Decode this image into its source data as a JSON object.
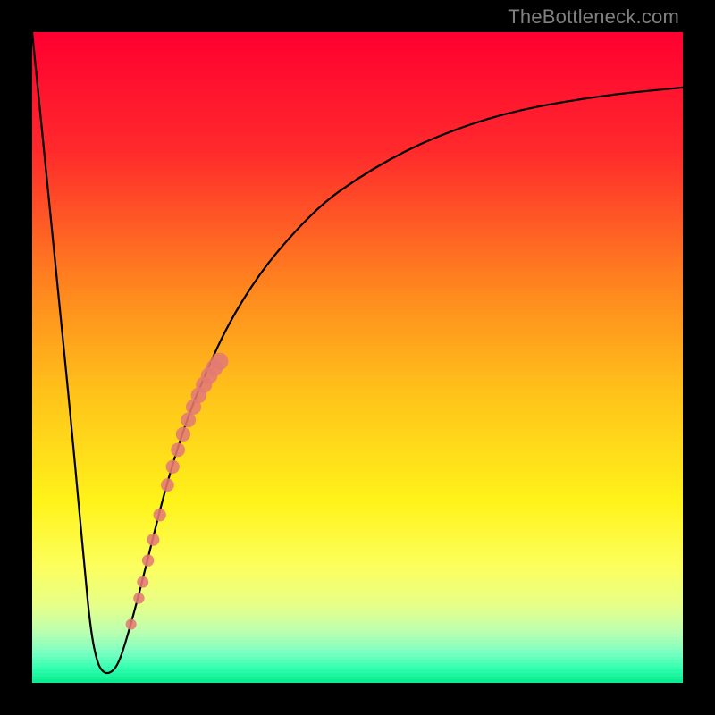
{
  "watermark": {
    "text": "TheBottleneck.com"
  },
  "chart_data": {
    "type": "line",
    "title": "",
    "xlabel": "",
    "ylabel": "",
    "xlim": [
      0,
      100
    ],
    "ylim": [
      0,
      100
    ],
    "grid": false,
    "legend": false,
    "background_gradient": {
      "direction": "vertical",
      "stops": [
        {
          "pos": 0.0,
          "color": "#ff0030"
        },
        {
          "pos": 0.18,
          "color": "#ff2a2c"
        },
        {
          "pos": 0.4,
          "color": "#ff8a1e"
        },
        {
          "pos": 0.55,
          "color": "#ffc21a"
        },
        {
          "pos": 0.72,
          "color": "#fff31a"
        },
        {
          "pos": 0.82,
          "color": "#fcff5e"
        },
        {
          "pos": 0.88,
          "color": "#e6ff8a"
        },
        {
          "pos": 0.92,
          "color": "#baffb0"
        },
        {
          "pos": 0.95,
          "color": "#7dffc2"
        },
        {
          "pos": 0.975,
          "color": "#33ffb0"
        },
        {
          "pos": 1.0,
          "color": "#00e888"
        }
      ]
    },
    "series": [
      {
        "name": "bottleneck-curve",
        "color": "#000000",
        "stroke_width": 2.2,
        "x": [
          0,
          2,
          4,
          6,
          8,
          9,
          10,
          11,
          12,
          13,
          14,
          16,
          18,
          20,
          22,
          24,
          26,
          30,
          35,
          40,
          45,
          50,
          55,
          60,
          65,
          70,
          75,
          80,
          85,
          90,
          95,
          100
        ],
        "y": [
          100,
          80,
          60,
          40,
          18,
          8,
          3,
          1.5,
          1.5,
          2.5,
          5,
          12,
          20,
          28,
          35,
          41,
          46,
          55,
          63,
          69,
          74,
          77.5,
          80.5,
          83,
          85,
          86.7,
          88,
          89,
          89.8,
          90.5,
          91,
          91.5
        ]
      },
      {
        "name": "sample-points",
        "type": "scatter",
        "color": "#e47a74",
        "radius": 6,
        "x": [
          15.2,
          16.4,
          17.0,
          17.8,
          18.6,
          19.6,
          20.8,
          21.6,
          22.4,
          23.2,
          24.0,
          24.8,
          25.6,
          26.4,
          27.2,
          28.0,
          28.8
        ],
        "y": [
          9.0,
          13.0,
          15.5,
          18.8,
          22.0,
          25.8,
          30.4,
          33.2,
          35.8,
          38.2,
          40.4,
          42.4,
          44.2,
          45.8,
          47.2,
          48.4,
          49.4
        ]
      }
    ]
  }
}
